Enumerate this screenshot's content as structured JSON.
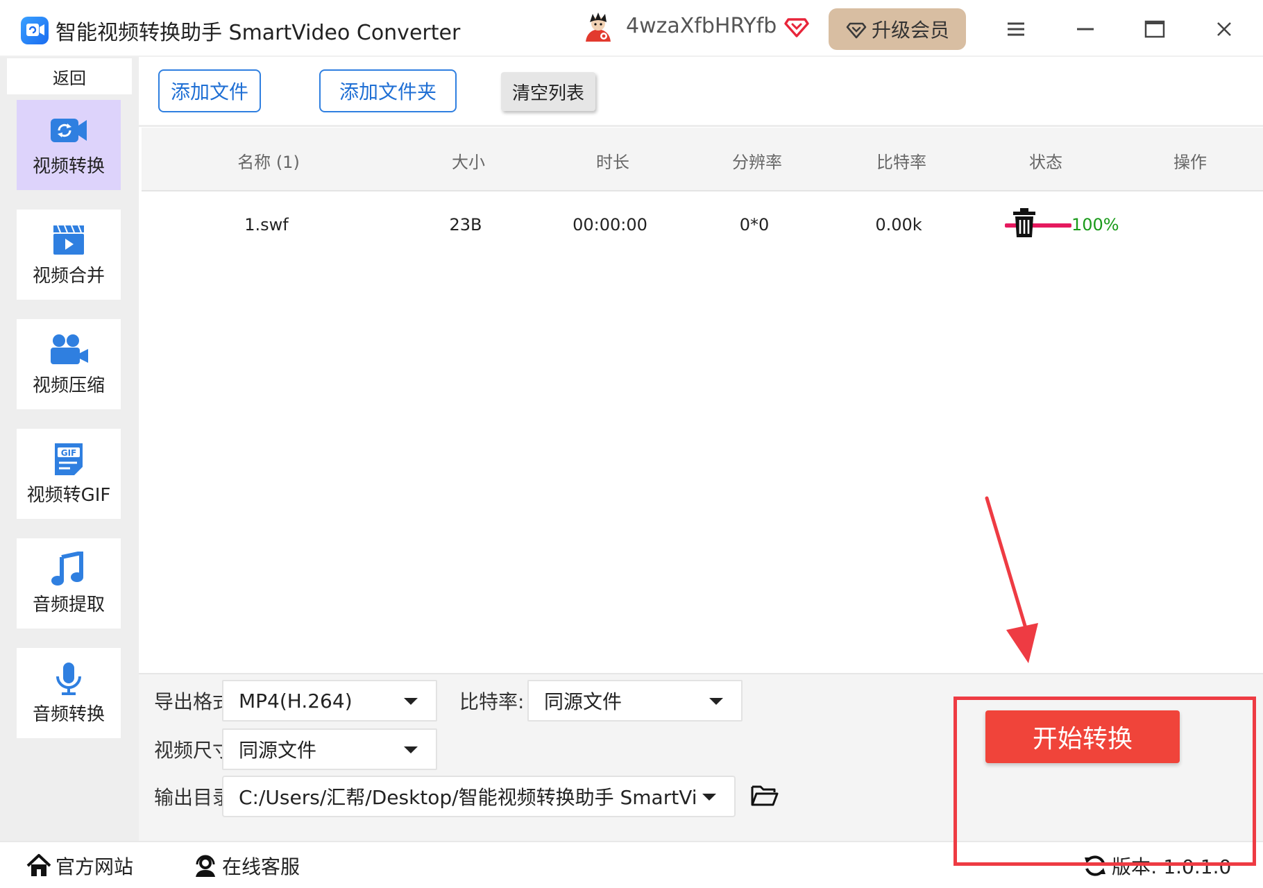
{
  "titlebar": {
    "title": "智能视频转换助手 SmartVideo Converter",
    "username": "4wzaXfbHRYfb",
    "upgrade_label": "升级会员",
    "logo_icon": "video-convert-logo",
    "vip_icon": "diamond-heart-icon",
    "menu_icon": "hamburger-menu-icon",
    "minimize_icon": "minimize-icon",
    "maximize_icon": "maximize-icon",
    "close_icon": "close-icon"
  },
  "sidebar": {
    "back_label": "返回",
    "items": [
      {
        "label": "视频转换",
        "icon": "video-convert-icon",
        "active": true
      },
      {
        "label": "视频合并",
        "icon": "video-merge-icon",
        "active": false
      },
      {
        "label": "视频压缩",
        "icon": "video-compress-icon",
        "active": false
      },
      {
        "label": "视频转GIF",
        "icon": "gif-icon",
        "active": false
      },
      {
        "label": "音频提取",
        "icon": "music-note-icon",
        "active": false
      },
      {
        "label": "音频转换",
        "icon": "microphone-icon",
        "active": false
      }
    ]
  },
  "toolbar": {
    "add_file_label": "添加文件",
    "add_folder_label": "添加文件夹",
    "clear_label": "清空列表"
  },
  "table": {
    "headers": [
      "名称 (1)",
      "大小",
      "时长",
      "分辨率",
      "比特率",
      "状态",
      "操作"
    ],
    "rows": [
      {
        "name": "1.swf",
        "size": "23B",
        "duration": "00:00:00",
        "resolution": "0*0",
        "bitrate": "0.00k",
        "progress": 1.0,
        "status": "100%",
        "action_icon": "trash-icon"
      }
    ]
  },
  "settings": {
    "format_label": "导出格式:",
    "format_value": "MP4(H.264)",
    "bitrate_label": "比特率:",
    "bitrate_value": "同源文件",
    "size_label": "视频尺寸:",
    "size_value": "同源文件",
    "output_label": "输出目录:",
    "output_value": "C:/Users/汇帮/Desktop/智能视频转换助手 SmartVideo Cor",
    "folder_icon": "folder-open-icon",
    "start_label": "开始转换"
  },
  "footer": {
    "website_label": "官方网站",
    "support_label": "在线客服",
    "version_label": "版本: 1.0.1.0",
    "home_icon": "home-icon",
    "support_icon": "headset-icon",
    "refresh_icon": "refresh-icon"
  },
  "colors": {
    "accent_blue": "#2f7fe0",
    "start_button": "#f0443a",
    "upgrade_button": "#d8bea2",
    "active_nav": "#ddd3fb",
    "progress_bar": "#e5195e",
    "progress_text": "#1a9a1a",
    "annotation_red": "#ee3b43"
  }
}
